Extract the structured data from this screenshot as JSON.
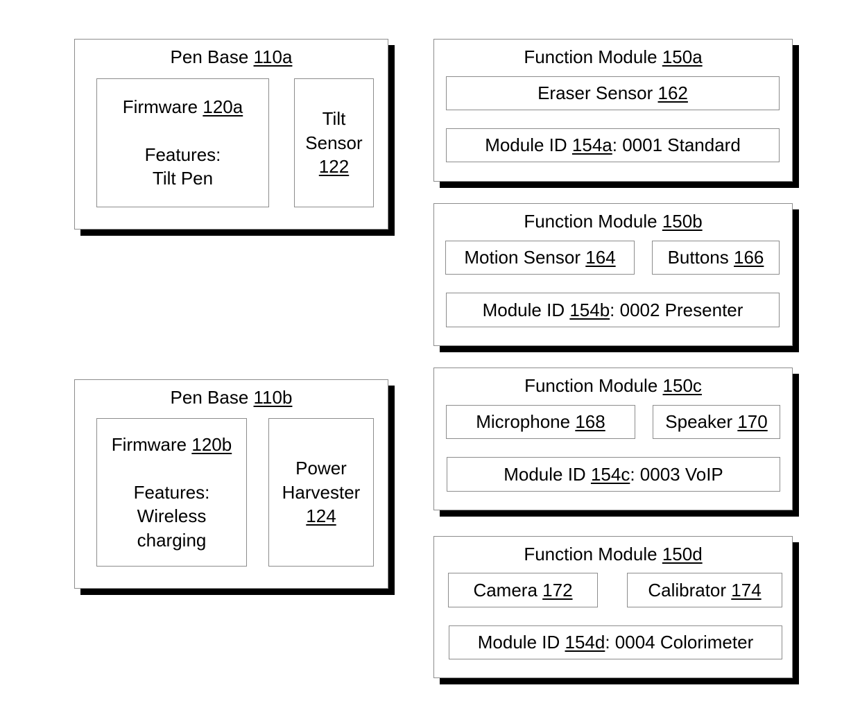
{
  "pen_bases": [
    {
      "title": "Pen Base",
      "ref": "110a",
      "firmware": {
        "title": "Firmware",
        "ref": "120a",
        "features_label": "Features:",
        "features": [
          "Tilt Pen"
        ]
      },
      "component": {
        "lines": [
          "Tilt",
          "Sensor"
        ],
        "ref": "122"
      }
    },
    {
      "title": "Pen Base",
      "ref": "110b",
      "firmware": {
        "title": "Firmware",
        "ref": "120b",
        "features_label": "Features:",
        "features": [
          "Wireless",
          "charging"
        ]
      },
      "component": {
        "lines": [
          "Power",
          "Harvester"
        ],
        "ref": "124"
      }
    }
  ],
  "function_modules": [
    {
      "title": "Function Module",
      "ref": "150a",
      "components": [
        {
          "label": "Eraser Sensor",
          "ref": "162"
        }
      ],
      "module_id": {
        "label": "Module ID",
        "ref": "154a",
        "value": ": 0001 Standard"
      }
    },
    {
      "title": "Function Module",
      "ref": "150b",
      "components": [
        {
          "label": "Motion Sensor",
          "ref": "164"
        },
        {
          "label": "Buttons",
          "ref": "166"
        }
      ],
      "module_id": {
        "label": "Module ID",
        "ref": "154b",
        "value": ": 0002 Presenter"
      }
    },
    {
      "title": "Function Module",
      "ref": "150c",
      "components": [
        {
          "label": "Microphone",
          "ref": "168"
        },
        {
          "label": "Speaker",
          "ref": "170"
        }
      ],
      "module_id": {
        "label": "Module ID",
        "ref": "154c",
        "value": ": 0003 VoIP"
      }
    },
    {
      "title": "Function Module",
      "ref": "150d",
      "components": [
        {
          "label": "Camera",
          "ref": "172"
        },
        {
          "label": "Calibrator",
          "ref": "174"
        }
      ],
      "module_id": {
        "label": "Module ID",
        "ref": "154d",
        "value": ": 0004 Colorimeter"
      }
    }
  ]
}
